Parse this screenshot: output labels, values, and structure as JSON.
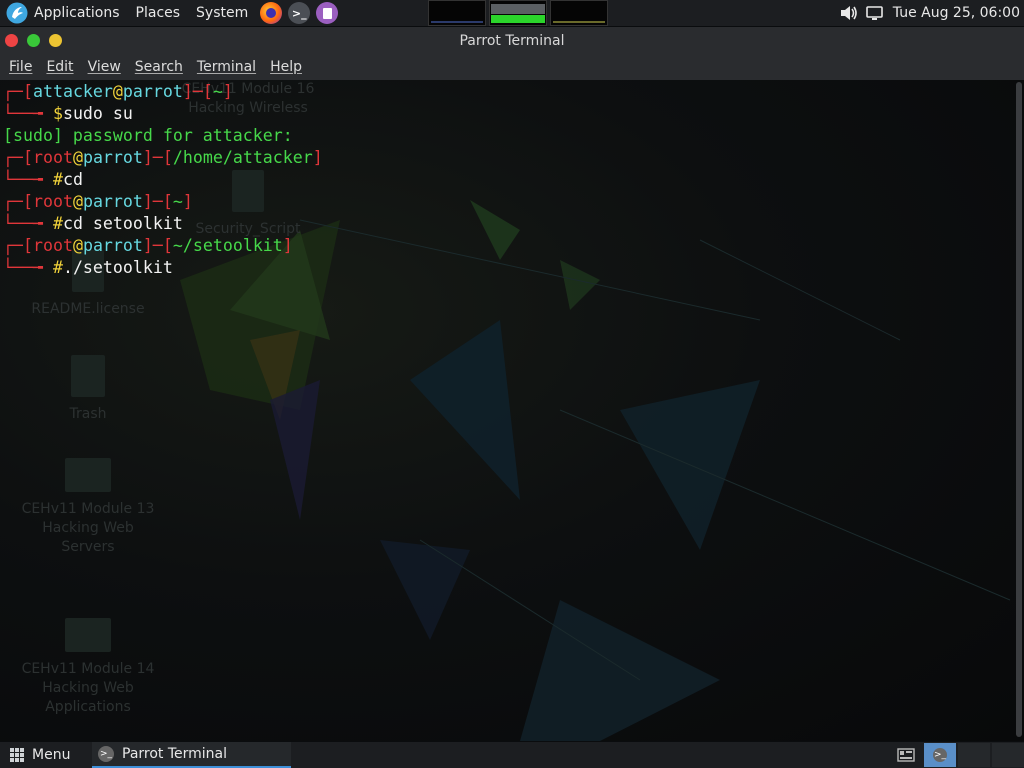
{
  "top_panel": {
    "applications": "Applications",
    "places": "Places",
    "system": "System",
    "launchers": [
      "firefox-icon",
      "terminal-icon",
      "text-editor-icon"
    ],
    "clock": "Tue Aug 25, 06:00"
  },
  "window": {
    "title": "Parrot Terminal",
    "menu": [
      "File",
      "Edit",
      "View",
      "Search",
      "Terminal",
      "Help"
    ]
  },
  "terminal": {
    "lines": [
      {
        "type": "prompt",
        "user": "attacker",
        "host": "parrot",
        "dir": "~"
      },
      {
        "type": "cmd",
        "sym": "$",
        "text": "sudo su"
      },
      {
        "type": "out",
        "text": "[sudo] password for attacker:"
      },
      {
        "type": "prompt",
        "user": "root",
        "host": "parrot",
        "dir": "/home/attacker"
      },
      {
        "type": "cmd",
        "sym": "#",
        "text": "cd"
      },
      {
        "type": "prompt",
        "user": "root",
        "host": "parrot",
        "dir": "~"
      },
      {
        "type": "cmd",
        "sym": "#",
        "text": "cd setoolkit"
      },
      {
        "type": "prompt",
        "user": "root",
        "host": "parrot",
        "dir": "~/setoolkit"
      },
      {
        "type": "cmd",
        "sym": "#",
        "text": "./setoolkit"
      }
    ]
  },
  "desktop_icons": [
    {
      "label": "CEHv11 Module 16\nHacking Wireless"
    },
    {
      "label": "Security_Script"
    },
    {
      "label": "README.license"
    },
    {
      "label": "Trash"
    },
    {
      "label": "CEHv11 Module 13\nHacking Web\nServers"
    },
    {
      "label": "CEHv11 Module 14\nHacking Web\nApplications"
    }
  ],
  "bottom_panel": {
    "menu": "Menu",
    "task": "Parrot Terminal"
  },
  "colors": {
    "panel": "#1c1e21",
    "prompt_bracket": "#e0363a",
    "prompt_user": "#66d8e0",
    "prompt_at": "#f0d23a",
    "output": "#46d84a"
  }
}
